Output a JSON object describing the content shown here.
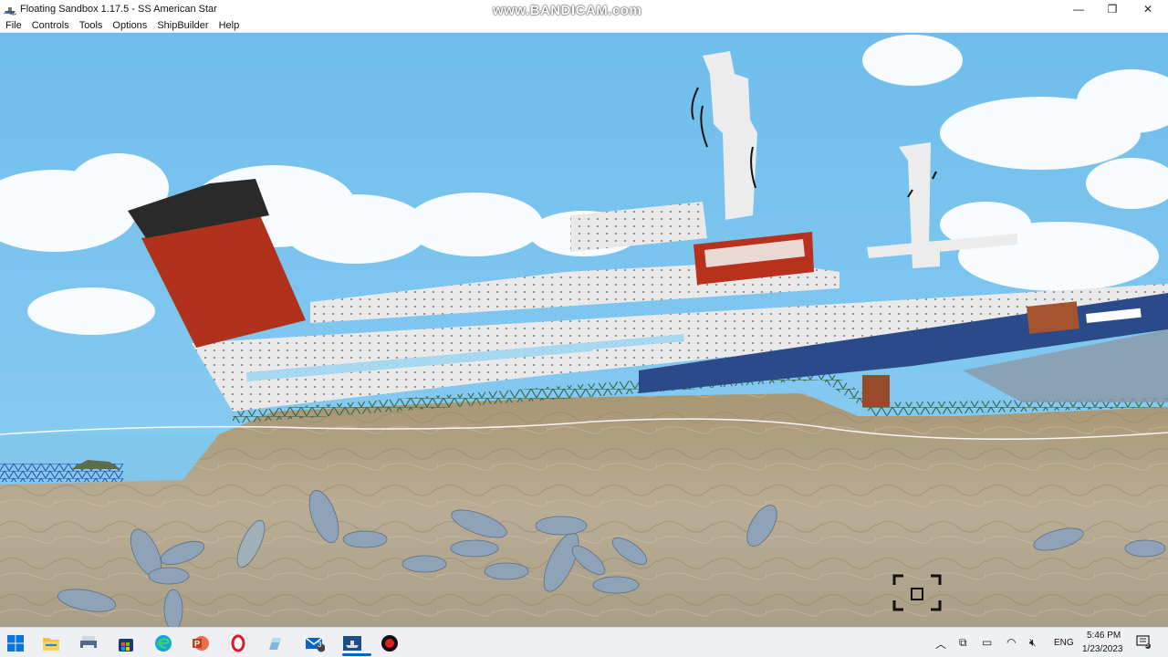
{
  "window": {
    "title": "Floating Sandbox 1.17.5 - SS American Star",
    "minimize_glyph": "—",
    "restore_glyph": "❐",
    "close_glyph": "✕"
  },
  "watermark": "www.BANDICAM.com",
  "menu": [
    "File",
    "Controls",
    "Tools",
    "Options",
    "ShipBuilder",
    "Help"
  ],
  "scene": {
    "sky_color": "#7cc4ef",
    "rock_color": "#b4a58a",
    "hull_blue": "#2b4a8a",
    "funnel_red": "#b0321c",
    "cursor_icon": "screen-capture-target-icon"
  },
  "taskbar": {
    "icons": [
      "windows-start-icon",
      "file-explorer-icon",
      "printer-app-icon",
      "microsoft-store-icon",
      "edge-browser-icon",
      "powerpoint-icon",
      "opera-browser-icon",
      "pen-app-icon",
      "mail-icon",
      "floating-sandbox-icon",
      "bandicam-record-icon"
    ],
    "mail_badge": "3",
    "language": "ENG",
    "time": "5:46 PM",
    "date": "1/23/2023",
    "notification_badge": "5"
  }
}
